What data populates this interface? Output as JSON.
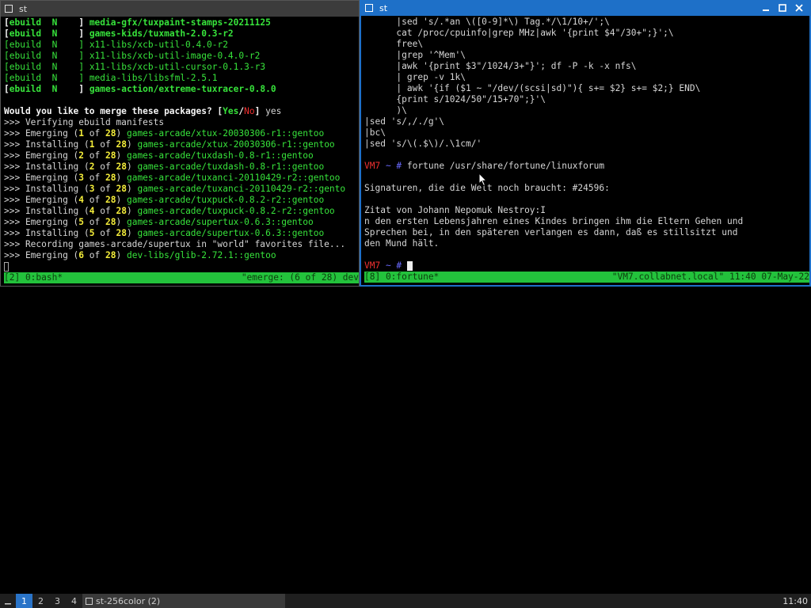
{
  "left_window": {
    "title": "st",
    "lines": [
      [
        {
          "t": "[",
          "c": "white"
        },
        {
          "t": "ebuild",
          "c": "bgreen"
        },
        {
          "t": "  N    ",
          "c": "bgreen"
        },
        {
          "t": "] ",
          "c": "white"
        },
        {
          "t": "media-gfx/tuxpaint-stamps-20211125",
          "c": "bgreen"
        }
      ],
      [
        {
          "t": "[",
          "c": "white"
        },
        {
          "t": "ebuild",
          "c": "bgreen"
        },
        {
          "t": "  N    ",
          "c": "bgreen"
        },
        {
          "t": "] ",
          "c": "white"
        },
        {
          "t": "games-kids/tuxmath-2.0.3-r2",
          "c": "bgreen"
        }
      ],
      [
        {
          "t": "[",
          "c": "green"
        },
        {
          "t": "ebuild",
          "c": "green"
        },
        {
          "t": "  N    ",
          "c": "green"
        },
        {
          "t": "] ",
          "c": "green"
        },
        {
          "t": "x11-libs/xcb-util-0.4.0-r2",
          "c": "green"
        }
      ],
      [
        {
          "t": "[",
          "c": "green"
        },
        {
          "t": "ebuild",
          "c": "green"
        },
        {
          "t": "  N    ",
          "c": "green"
        },
        {
          "t": "] ",
          "c": "green"
        },
        {
          "t": "x11-libs/xcb-util-image-0.4.0-r2",
          "c": "green"
        }
      ],
      [
        {
          "t": "[",
          "c": "green"
        },
        {
          "t": "ebuild",
          "c": "green"
        },
        {
          "t": "  N    ",
          "c": "green"
        },
        {
          "t": "] ",
          "c": "green"
        },
        {
          "t": "x11-libs/xcb-util-cursor-0.1.3-r3",
          "c": "green"
        }
      ],
      [
        {
          "t": "[",
          "c": "green"
        },
        {
          "t": "ebuild",
          "c": "green"
        },
        {
          "t": "  N    ",
          "c": "green"
        },
        {
          "t": "] ",
          "c": "green"
        },
        {
          "t": "media-libs/libsfml-2.5.1",
          "c": "green"
        }
      ],
      [
        {
          "t": "[",
          "c": "white"
        },
        {
          "t": "ebuild",
          "c": "bgreen"
        },
        {
          "t": "  N    ",
          "c": "bgreen"
        },
        {
          "t": "] ",
          "c": "white"
        },
        {
          "t": "games-action/extreme-tuxracer-0.8.0",
          "c": "bgreen"
        }
      ],
      [],
      [
        {
          "t": "Would you like to merge these packages? ",
          "c": "white"
        },
        {
          "t": "[",
          "c": "white"
        },
        {
          "t": "Yes",
          "c": "bgreen"
        },
        {
          "t": "/",
          "c": "white"
        },
        {
          "t": "No",
          "c": "red"
        },
        {
          "t": "]",
          "c": "white"
        },
        {
          "t": " yes",
          "c": ""
        }
      ],
      [
        {
          "t": ">>> Verifying ebuild manifests",
          "c": ""
        }
      ],
      [
        {
          "t": ">>> Emerging (",
          "c": ""
        },
        {
          "t": "1",
          "c": "yellow"
        },
        {
          "t": " of ",
          "c": ""
        },
        {
          "t": "28",
          "c": "yellow"
        },
        {
          "t": ") ",
          "c": ""
        },
        {
          "t": "games-arcade/xtux-20030306-r1::gentoo",
          "c": "green"
        }
      ],
      [
        {
          "t": ">>> Installing (",
          "c": ""
        },
        {
          "t": "1",
          "c": "yellow"
        },
        {
          "t": " of ",
          "c": ""
        },
        {
          "t": "28",
          "c": "yellow"
        },
        {
          "t": ") ",
          "c": ""
        },
        {
          "t": "games-arcade/xtux-20030306-r1::gentoo",
          "c": "green"
        }
      ],
      [
        {
          "t": ">>> Emerging (",
          "c": ""
        },
        {
          "t": "2",
          "c": "yellow"
        },
        {
          "t": " of ",
          "c": ""
        },
        {
          "t": "28",
          "c": "yellow"
        },
        {
          "t": ") ",
          "c": ""
        },
        {
          "t": "games-arcade/tuxdash-0.8-r1::gentoo",
          "c": "green"
        }
      ],
      [
        {
          "t": ">>> Installing (",
          "c": ""
        },
        {
          "t": "2",
          "c": "yellow"
        },
        {
          "t": " of ",
          "c": ""
        },
        {
          "t": "28",
          "c": "yellow"
        },
        {
          "t": ") ",
          "c": ""
        },
        {
          "t": "games-arcade/tuxdash-0.8-r1::gentoo",
          "c": "green"
        }
      ],
      [
        {
          "t": ">>> Emerging (",
          "c": ""
        },
        {
          "t": "3",
          "c": "yellow"
        },
        {
          "t": " of ",
          "c": ""
        },
        {
          "t": "28",
          "c": "yellow"
        },
        {
          "t": ") ",
          "c": ""
        },
        {
          "t": "games-arcade/tuxanci-20110429-r2::gentoo",
          "c": "green"
        }
      ],
      [
        {
          "t": ">>> Installing (",
          "c": ""
        },
        {
          "t": "3",
          "c": "yellow"
        },
        {
          "t": " of ",
          "c": ""
        },
        {
          "t": "28",
          "c": "yellow"
        },
        {
          "t": ") ",
          "c": ""
        },
        {
          "t": "games-arcade/tuxanci-20110429-r2::gento",
          "c": "green"
        }
      ],
      [
        {
          "t": ">>> Emerging (",
          "c": ""
        },
        {
          "t": "4",
          "c": "yellow"
        },
        {
          "t": " of ",
          "c": ""
        },
        {
          "t": "28",
          "c": "yellow"
        },
        {
          "t": ") ",
          "c": ""
        },
        {
          "t": "games-arcade/tuxpuck-0.8.2-r2::gentoo",
          "c": "green"
        }
      ],
      [
        {
          "t": ">>> Installing (",
          "c": ""
        },
        {
          "t": "4",
          "c": "yellow"
        },
        {
          "t": " of ",
          "c": ""
        },
        {
          "t": "28",
          "c": "yellow"
        },
        {
          "t": ") ",
          "c": ""
        },
        {
          "t": "games-arcade/tuxpuck-0.8.2-r2::gentoo",
          "c": "green"
        }
      ],
      [
        {
          "t": ">>> Emerging (",
          "c": ""
        },
        {
          "t": "5",
          "c": "yellow"
        },
        {
          "t": " of ",
          "c": ""
        },
        {
          "t": "28",
          "c": "yellow"
        },
        {
          "t": ") ",
          "c": ""
        },
        {
          "t": "games-arcade/supertux-0.6.3::gentoo",
          "c": "green"
        }
      ],
      [
        {
          "t": ">>> Installing (",
          "c": ""
        },
        {
          "t": "5",
          "c": "yellow"
        },
        {
          "t": " of ",
          "c": ""
        },
        {
          "t": "28",
          "c": "yellow"
        },
        {
          "t": ") ",
          "c": ""
        },
        {
          "t": "games-arcade/supertux-0.6.3::gentoo",
          "c": "green"
        }
      ],
      [
        {
          "t": ">>> Recording games-arcade/supertux in \"world\" favorites file...",
          "c": ""
        }
      ],
      [
        {
          "t": ">>> Emerging (",
          "c": ""
        },
        {
          "t": "6",
          "c": "yellow"
        },
        {
          "t": " of ",
          "c": ""
        },
        {
          "t": "28",
          "c": "yellow"
        },
        {
          "t": ") ",
          "c": ""
        },
        {
          "t": "dev-libs/glib-2.72.1::gentoo",
          "c": "green"
        }
      ]
    ],
    "status_left": "[2] 0:bash*",
    "status_right": "\"emerge: (6 of 28) dev"
  },
  "right_window": {
    "title": "st",
    "lines": [
      [
        {
          "t": "      |sed 's/.*an \\([0-9]*\\) Tag.*/\\1/10+/';\\",
          "c": ""
        }
      ],
      [
        {
          "t": "      cat /proc/cpuinfo|grep MHz|awk '{print $4\"/30+\";}';\\",
          "c": ""
        }
      ],
      [
        {
          "t": "      free\\",
          "c": ""
        }
      ],
      [
        {
          "t": "      |grep '^Mem'\\",
          "c": ""
        }
      ],
      [
        {
          "t": "      |awk '{print $3\"/1024/3+\"}'; df -P -k -x nfs\\",
          "c": ""
        }
      ],
      [
        {
          "t": "      | grep -v 1k\\",
          "c": ""
        }
      ],
      [
        {
          "t": "      | awk '{if ($1 ~ \"/dev/(scsi|sd)\"){ s+= $2} s+= $2;} END\\",
          "c": ""
        }
      ],
      [
        {
          "t": "      {print s/1024/50\"/15+70\";}'\\",
          "c": ""
        }
      ],
      [
        {
          "t": "      )\\",
          "c": ""
        }
      ],
      [
        {
          "t": "|sed 's/,/./g'\\",
          "c": ""
        }
      ],
      [
        {
          "t": "|bc\\",
          "c": ""
        }
      ],
      [
        {
          "t": "|sed 's/\\(.$\\)/.\\1cm/'",
          "c": ""
        }
      ],
      [],
      [
        {
          "t": "VM7",
          "c": "red"
        },
        {
          "t": " ~ # ",
          "c": "blue"
        },
        {
          "t": "fortune /usr/share/fortune/linuxforum",
          "c": ""
        }
      ],
      [],
      [
        {
          "t": "Signaturen, die die Welt noch braucht: #24596:",
          "c": ""
        }
      ],
      [],
      [
        {
          "t": "Zitat von Johann Nepomuk Nestroy:I",
          "c": ""
        }
      ],
      [
        {
          "t": "n den ersten Lebensjahren eines Kindes bringen ihm die Eltern Gehen und",
          "c": ""
        }
      ],
      [
        {
          "t": "Sprechen bei, in den späteren verlangen es dann, daß es stillsitzt und",
          "c": ""
        }
      ],
      [
        {
          "t": "den Mund hält.",
          "c": ""
        }
      ],
      [],
      [
        {
          "t": "VM7",
          "c": "red"
        },
        {
          "t": " ~ # ",
          "c": "blue"
        }
      ]
    ],
    "status_left": "[8] 0:fortune*",
    "status_right": "\"VM7.collabnet.local\" 11:40 07-May-22"
  },
  "taskbar": {
    "workspaces": [
      "1",
      "2",
      "3",
      "4"
    ],
    "active_workspace": "1",
    "task_label": "st-256color (2)",
    "clock": "11:40"
  },
  "colors": {
    "accent": "#1e70c8",
    "status_bar": "#23c23c"
  }
}
